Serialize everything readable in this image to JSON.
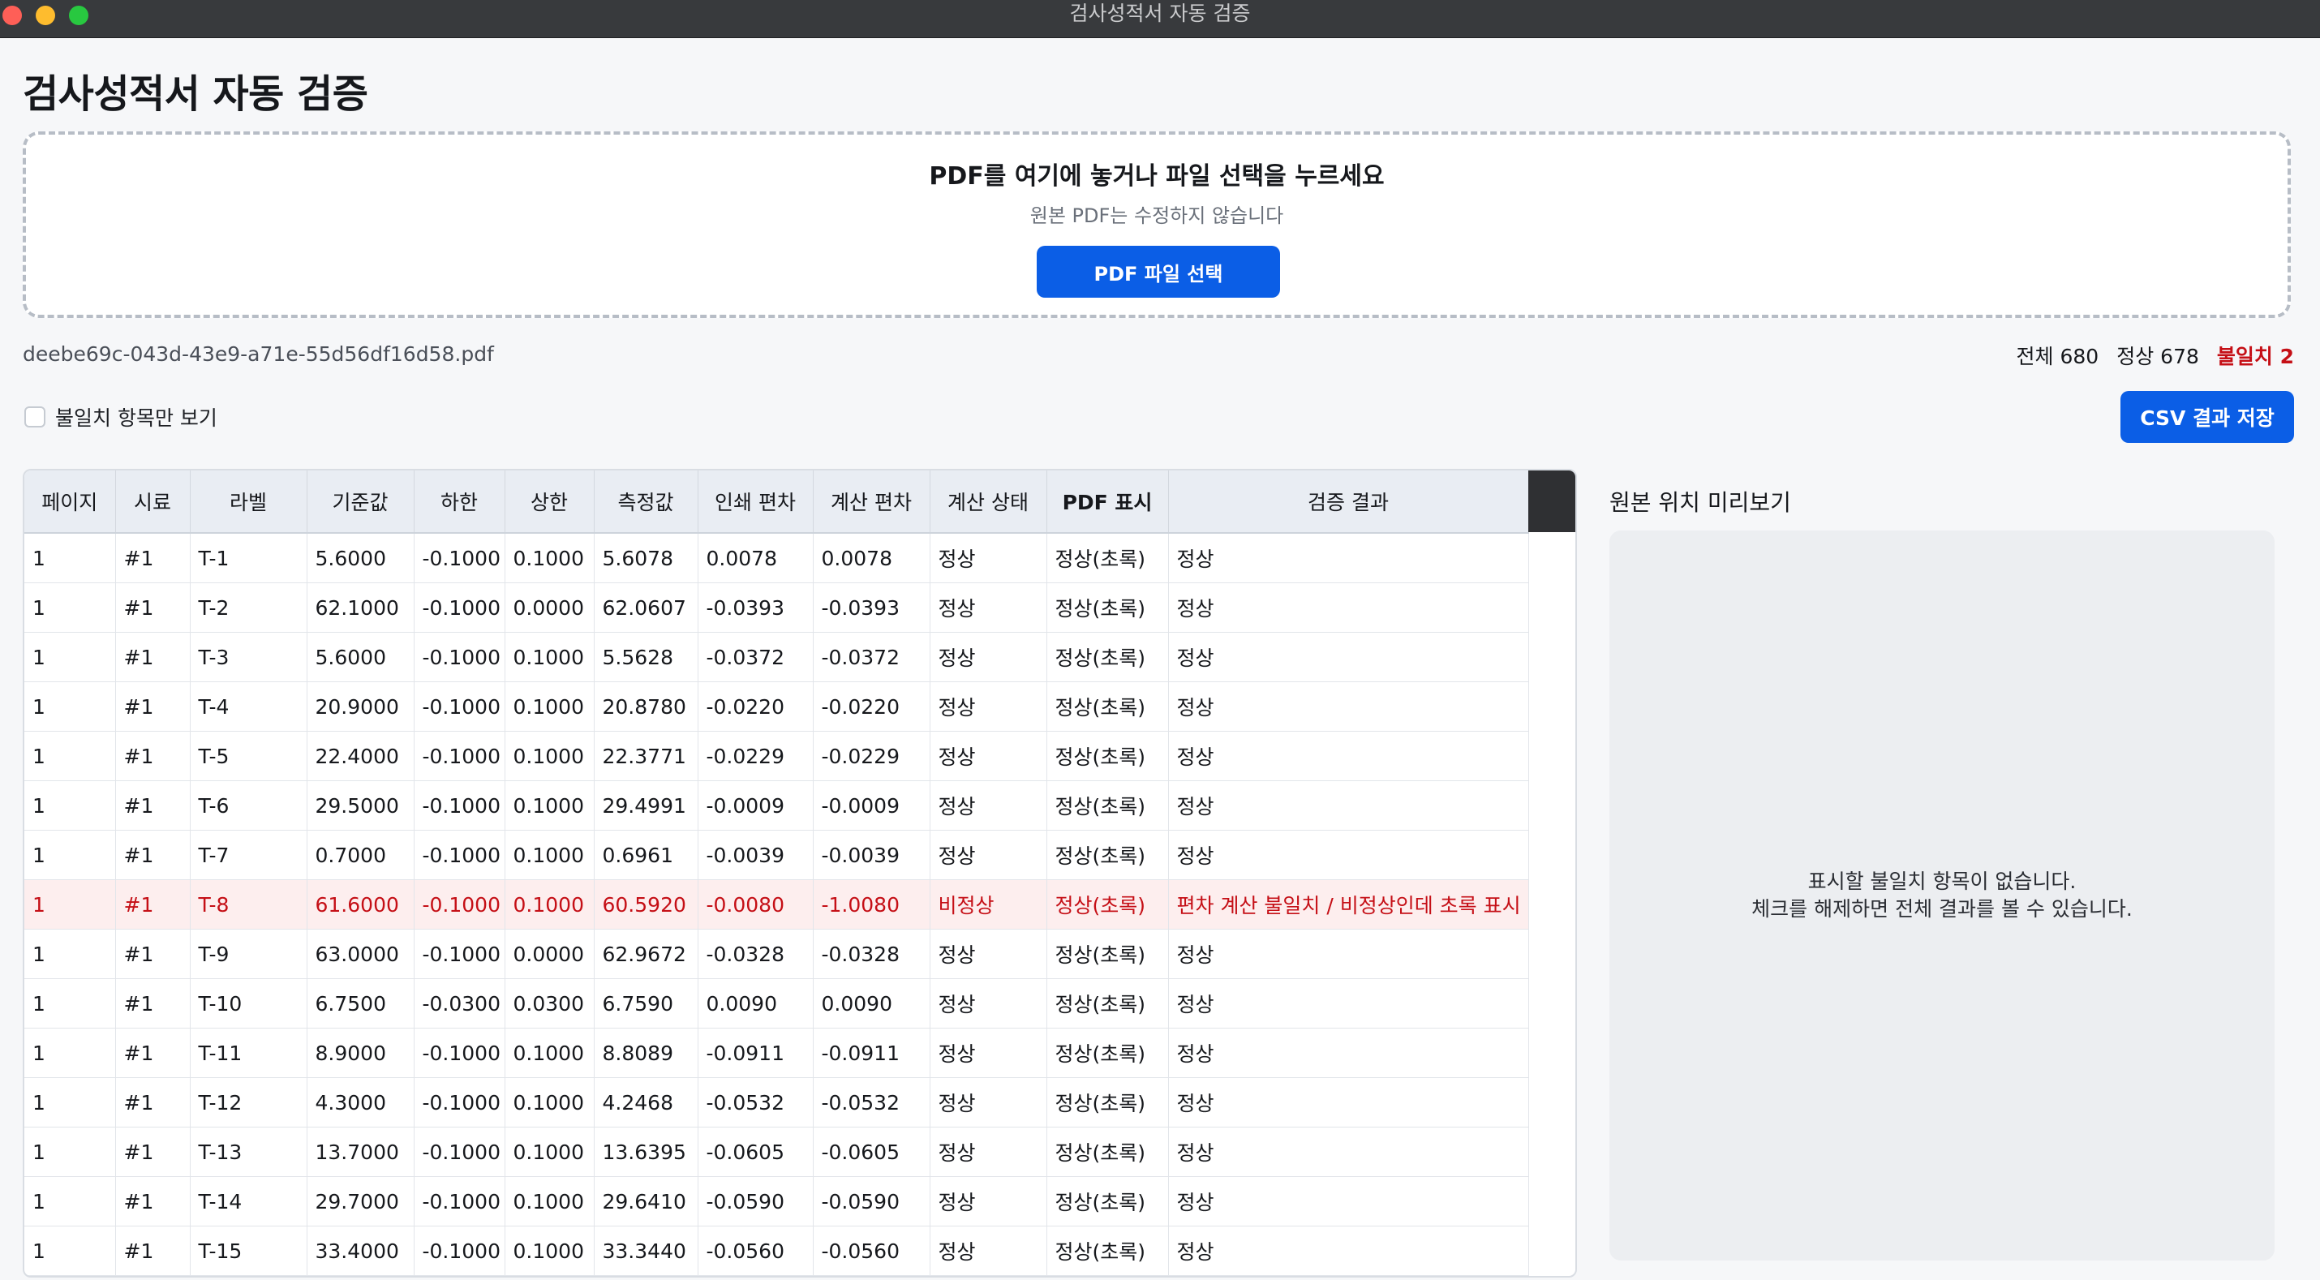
{
  "window": {
    "title": "검사성적서 자동 검증"
  },
  "app": {
    "title": "검사성적서 자동 검증"
  },
  "dropzone": {
    "title": "PDF를 여기에 놓거나 파일 선택을 누르세요",
    "subtitle": "원본 PDF는 수정하지 않습니다",
    "button_label": "PDF 파일 선택"
  },
  "file": {
    "name": "deebe69c-043d-43e9-a71e-55d56df16d58.pdf"
  },
  "summary": {
    "total": "전체 680",
    "normal": "정상 678",
    "mismatch": "불일치 2"
  },
  "filter": {
    "label": "불일치 항목만 보기",
    "checked": false
  },
  "csv_button": {
    "label": "CSV 결과 저장"
  },
  "table": {
    "columns": [
      "페이지",
      "시료",
      "라벨",
      "기준값",
      "하한",
      "상한",
      "측정값",
      "인쇄 편차",
      "계산 편차",
      "계산 상태",
      "PDF 표시",
      "검증 결과"
    ],
    "rows": [
      {
        "cells": [
          "1",
          "#1",
          "T-1",
          "5.6000",
          "-0.1000",
          "0.1000",
          "5.6078",
          "0.0078",
          "0.0078",
          "정상",
          "정상(초록)",
          "정상"
        ],
        "mismatch": false
      },
      {
        "cells": [
          "1",
          "#1",
          "T-2",
          "62.1000",
          "-0.1000",
          "0.0000",
          "62.0607",
          "-0.0393",
          "-0.0393",
          "정상",
          "정상(초록)",
          "정상"
        ],
        "mismatch": false
      },
      {
        "cells": [
          "1",
          "#1",
          "T-3",
          "5.6000",
          "-0.1000",
          "0.1000",
          "5.5628",
          "-0.0372",
          "-0.0372",
          "정상",
          "정상(초록)",
          "정상"
        ],
        "mismatch": false
      },
      {
        "cells": [
          "1",
          "#1",
          "T-4",
          "20.9000",
          "-0.1000",
          "0.1000",
          "20.8780",
          "-0.0220",
          "-0.0220",
          "정상",
          "정상(초록)",
          "정상"
        ],
        "mismatch": false
      },
      {
        "cells": [
          "1",
          "#1",
          "T-5",
          "22.4000",
          "-0.1000",
          "0.1000",
          "22.3771",
          "-0.0229",
          "-0.0229",
          "정상",
          "정상(초록)",
          "정상"
        ],
        "mismatch": false
      },
      {
        "cells": [
          "1",
          "#1",
          "T-6",
          "29.5000",
          "-0.1000",
          "0.1000",
          "29.4991",
          "-0.0009",
          "-0.0009",
          "정상",
          "정상(초록)",
          "정상"
        ],
        "mismatch": false
      },
      {
        "cells": [
          "1",
          "#1",
          "T-7",
          "0.7000",
          "-0.1000",
          "0.1000",
          "0.6961",
          "-0.0039",
          "-0.0039",
          "정상",
          "정상(초록)",
          "정상"
        ],
        "mismatch": false
      },
      {
        "cells": [
          "1",
          "#1",
          "T-8",
          "61.6000",
          "-0.1000",
          "0.1000",
          "60.5920",
          "-0.0080",
          "-1.0080",
          "비정상",
          "정상(초록)",
          "편차 계산 불일치 / 비정상인데 초록 표시"
        ],
        "mismatch": true
      },
      {
        "cells": [
          "1",
          "#1",
          "T-9",
          "63.0000",
          "-0.1000",
          "0.0000",
          "62.9672",
          "-0.0328",
          "-0.0328",
          "정상",
          "정상(초록)",
          "정상"
        ],
        "mismatch": false
      },
      {
        "cells": [
          "1",
          "#1",
          "T-10",
          "6.7500",
          "-0.0300",
          "0.0300",
          "6.7590",
          "0.0090",
          "0.0090",
          "정상",
          "정상(초록)",
          "정상"
        ],
        "mismatch": false
      },
      {
        "cells": [
          "1",
          "#1",
          "T-11",
          "8.9000",
          "-0.1000",
          "0.1000",
          "8.8089",
          "-0.0911",
          "-0.0911",
          "정상",
          "정상(초록)",
          "정상"
        ],
        "mismatch": false
      },
      {
        "cells": [
          "1",
          "#1",
          "T-12",
          "4.3000",
          "-0.1000",
          "0.1000",
          "4.2468",
          "-0.0532",
          "-0.0532",
          "정상",
          "정상(초록)",
          "정상"
        ],
        "mismatch": false
      },
      {
        "cells": [
          "1",
          "#1",
          "T-13",
          "13.7000",
          "-0.1000",
          "0.1000",
          "13.6395",
          "-0.0605",
          "-0.0605",
          "정상",
          "정상(초록)",
          "정상"
        ],
        "mismatch": false
      },
      {
        "cells": [
          "1",
          "#1",
          "T-14",
          "29.7000",
          "-0.1000",
          "0.1000",
          "29.6410",
          "-0.0590",
          "-0.0590",
          "정상",
          "정상(초록)",
          "정상"
        ],
        "mismatch": false
      },
      {
        "cells": [
          "1",
          "#1",
          "T-15",
          "33.4000",
          "-0.1000",
          "0.1000",
          "33.3440",
          "-0.0560",
          "-0.0560",
          "정상",
          "정상(초록)",
          "정상"
        ],
        "mismatch": false
      }
    ]
  },
  "preview": {
    "title": "원본 위치 미리보기",
    "empty_line1": "표시할 불일치 항목이 없습니다.",
    "empty_line2": "체크를 해제하면 전체 결과를 볼 수 있습니다."
  },
  "colors": {
    "accent": "#0b5ee6",
    "mismatch_text": "#c50f16",
    "mismatch_row": "#fdeeee"
  }
}
